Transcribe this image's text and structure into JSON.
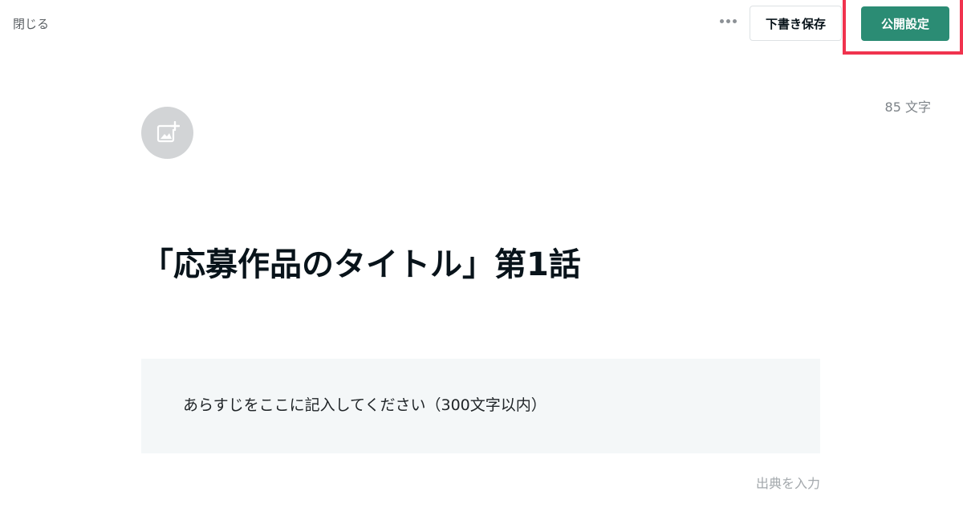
{
  "header": {
    "close_label": "閉じる",
    "more_icon": "more-horizontal-icon",
    "draft_save_label": "下書き保存",
    "publish_settings_label": "公開設定",
    "accent_color": "#2b8c74",
    "highlight_color": "#f0334e"
  },
  "editor": {
    "char_count": "85 文字",
    "add_image_icon": "add-image-icon",
    "title": "「応募作品のタイトル」第1話",
    "synopsis": "あらすじをここに記入してください（300文字以内）",
    "source_placeholder": "出典を入力"
  }
}
